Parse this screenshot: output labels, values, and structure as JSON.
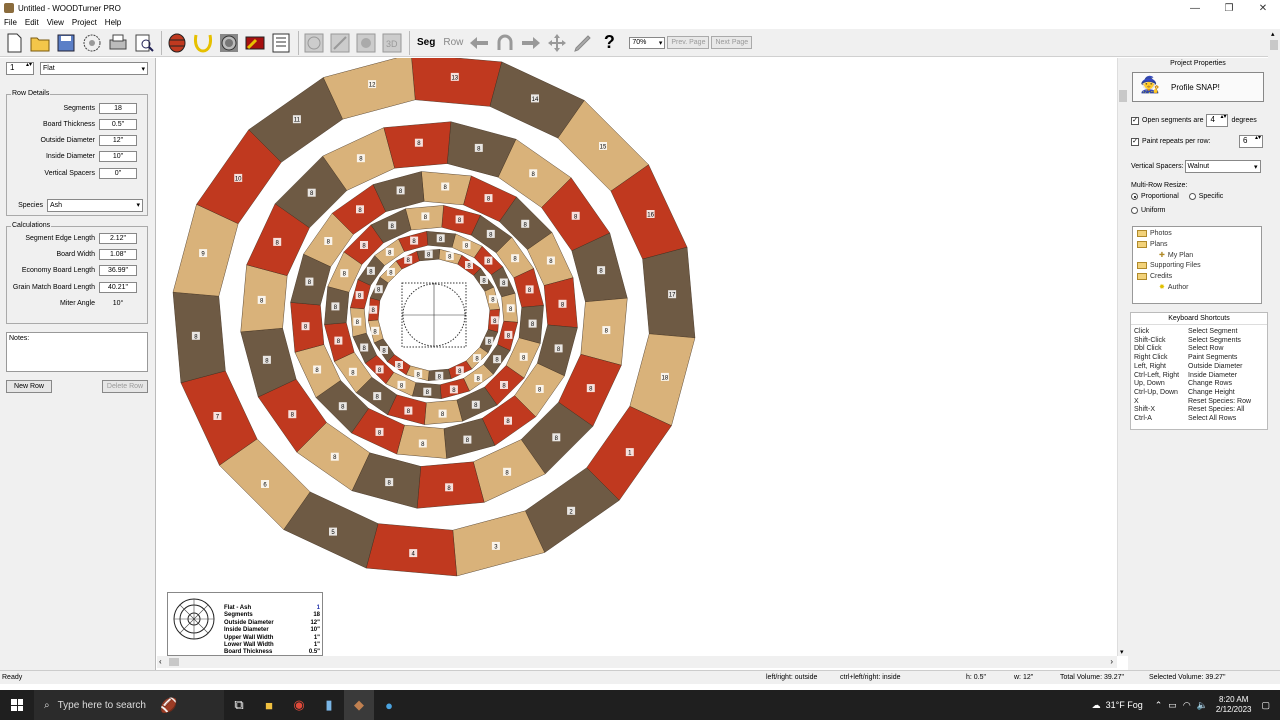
{
  "window": {
    "title": "Untitled - WOODTurner PRO"
  },
  "menu": [
    "File",
    "Edit",
    "View",
    "Project",
    "Help"
  ],
  "toolbar": {
    "seg_label": "Seg",
    "row_label": "Row",
    "help_label": "?",
    "zoom": "70%",
    "prev_page": "Prev. Page",
    "next_page": "Next Page"
  },
  "left": {
    "row_number": "1",
    "row_type": "Flat",
    "row_details_title": "Row Details",
    "fields": [
      {
        "label": "Segments",
        "value": "18"
      },
      {
        "label": "Board Thickness",
        "value": "0.5\""
      },
      {
        "label": "Outside Diameter",
        "value": "12\""
      },
      {
        "label": "Inside Diameter",
        "value": "10\""
      },
      {
        "label": "Vertical Spacers",
        "value": "0\""
      }
    ],
    "species_label": "Species",
    "species": "Ash",
    "calc_title": "Calculations",
    "calcs": [
      {
        "label": "Segment Edge Length",
        "value": "2.12\""
      },
      {
        "label": "Board Width",
        "value": "1.08\""
      },
      {
        "label": "Economy Board Length",
        "value": "36.99\""
      },
      {
        "label": "Grain Match Board Length",
        "value": "40.21\""
      },
      {
        "label": "Miter Angle",
        "value": "10°"
      }
    ],
    "notes_label": "Notes:",
    "new_row": "New Row",
    "delete_row": "Delete Row"
  },
  "canvas": {
    "outer_ring_numbers": [
      "13",
      "14",
      "15",
      "16",
      "17",
      "18",
      "1",
      "2",
      "3",
      "4",
      "5",
      "6",
      "7",
      "8",
      "9",
      "10",
      "11",
      "12"
    ],
    "ring_digit": "8",
    "preview": {
      "title": "Flat - Ash",
      "row_no": "1",
      "rows": [
        {
          "label": "Segments",
          "value": "18"
        },
        {
          "label": "Outside Diameter",
          "value": "12\""
        },
        {
          "label": "Inside Diameter",
          "value": "10\""
        },
        {
          "label": "Upper Wall Width",
          "value": "1\""
        },
        {
          "label": "Lower Wall Width",
          "value": "1\""
        },
        {
          "label": "Board Thickness",
          "value": "0.5\""
        }
      ]
    }
  },
  "right": {
    "title": "Project Properties",
    "profile_snap": "Profile SNAP!",
    "open_segments_prefix": "Open segments are",
    "open_segments_value": "4",
    "open_segments_suffix": "degrees",
    "paint_repeats_label": "Paint repeats per row:",
    "paint_repeats_value": "6",
    "vertical_spacers_label": "Vertical Spacers:",
    "vertical_spacers_value": "Walnut",
    "multirow_label": "Multi-Row Resize:",
    "proportional": "Proportional",
    "specific": "Specific",
    "uniform": "Uniform",
    "tree": [
      {
        "label": "Photos"
      },
      {
        "label": "Plans"
      },
      {
        "label": "My Plan"
      },
      {
        "label": "Supporting Files"
      },
      {
        "label": "Credits"
      },
      {
        "label": "Author"
      }
    ],
    "shortcuts_title": "Keyboard Shortcuts",
    "shortcuts": [
      {
        "key": "Click",
        "action": "Select Segment"
      },
      {
        "key": "Shift-Click",
        "action": "Select Segments"
      },
      {
        "key": "Dbl Click",
        "action": "Select Row"
      },
      {
        "key": "Right Click",
        "action": "Paint Segments"
      },
      {
        "key": "Left, Right",
        "action": "Outside Diameter"
      },
      {
        "key": "Ctrl-Left, Right",
        "action": "Inside Diameter"
      },
      {
        "key": "Up, Down",
        "action": "Change Rows"
      },
      {
        "key": "Ctrl-Up, Down",
        "action": "Change Height"
      },
      {
        "key": "X",
        "action": "Reset Species: Row"
      },
      {
        "key": "Shift-X",
        "action": "Reset Species: All"
      },
      {
        "key": "Ctrl-A",
        "action": "Select All Rows"
      }
    ]
  },
  "status": {
    "ready": "Ready",
    "hint1": "left/right: outside",
    "hint2": "ctrl+left/right: inside",
    "h": "h: 0.5\"",
    "w": "w: 12\"",
    "total": "Total Volume: 39.27\"",
    "selected": "Selected Volume: 39.27\""
  },
  "taskbar": {
    "search_placeholder": "Type here to search",
    "weather": "31°F  Fog",
    "time": "8:20 AM",
    "date": "2/12/2023"
  },
  "colors": {
    "red": "#c0391f",
    "walnut": "#6e5a44",
    "ash": "#d9b27a",
    "panel": "#f0f0f0"
  }
}
